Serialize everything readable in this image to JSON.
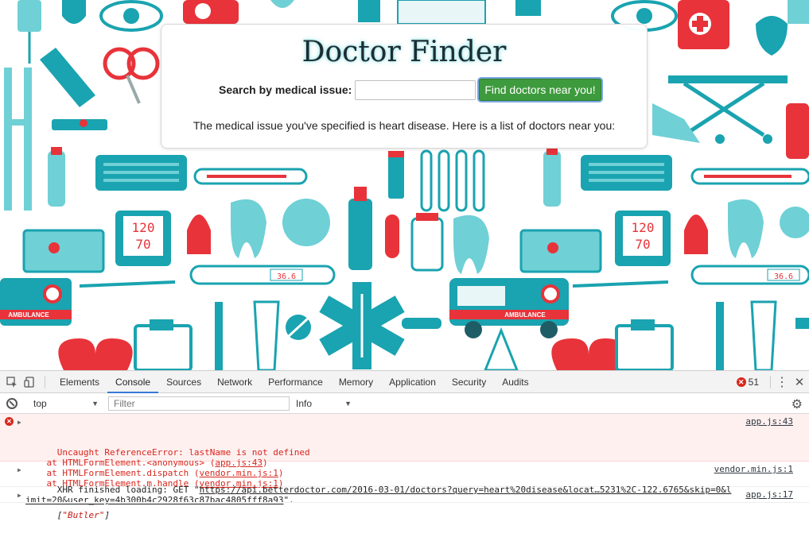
{
  "page": {
    "title": "Doctor Finder",
    "search_label": "Search by medical issue:",
    "search_value": "",
    "find_button": "Find doctors near you!",
    "result_message": "The medical issue you've specified is heart disease. Here is a list of doctors near you:",
    "background_labels": {
      "bp1": "120",
      "bp2": "70",
      "bp3": "120",
      "bp4": "70",
      "thermo1": "36.6",
      "thermo2": "36.6",
      "amb1": "AMBULANCE",
      "amb2": "AMBULANCE"
    },
    "colors": {
      "teal": "#1aa3b0",
      "red": "#e8333a",
      "light_teal": "#6fd0d6"
    }
  },
  "devtools": {
    "tabs": [
      "Elements",
      "Console",
      "Sources",
      "Network",
      "Performance",
      "Memory",
      "Application",
      "Security",
      "Audits"
    ],
    "active_tab": "Console",
    "error_count": "51",
    "context": "top",
    "filter_placeholder": "Filter",
    "level": "Info",
    "messages": {
      "error_line1": "Uncaught ReferenceError: lastName is not defined",
      "error_line2_prefix": "    at HTMLFormElement.<anonymous> (",
      "error_line2_link": "app.js:43",
      "error_line3_prefix": "    at HTMLFormElement.dispatch (",
      "error_line3_link": "vendor.min.js:1",
      "error_line4_prefix": "    at HTMLFormElement.m.handle (",
      "error_line4_link": "vendor.min.js:1",
      "close_paren": ")",
      "error_source": "app.js:43",
      "xhr_line1_prefix": "XHR finished loading: GET \"",
      "xhr_line1_url": "https://api.betterdoctor.com/2016-03-01/doctors?query=heart%20disease&locat…5231%2C-122.6765&skip=0&l",
      "xhr_line2_url": "imit=20&user_key=4b300b4c2928f63c87bac4805fff8a93",
      "xhr_line2_suffix": "\".",
      "xhr_source": "vendor.min.js:1",
      "obj_open": "[",
      "obj_value": "\"Butler\"",
      "obj_close": "]",
      "obj_source": "app.js:17"
    }
  }
}
